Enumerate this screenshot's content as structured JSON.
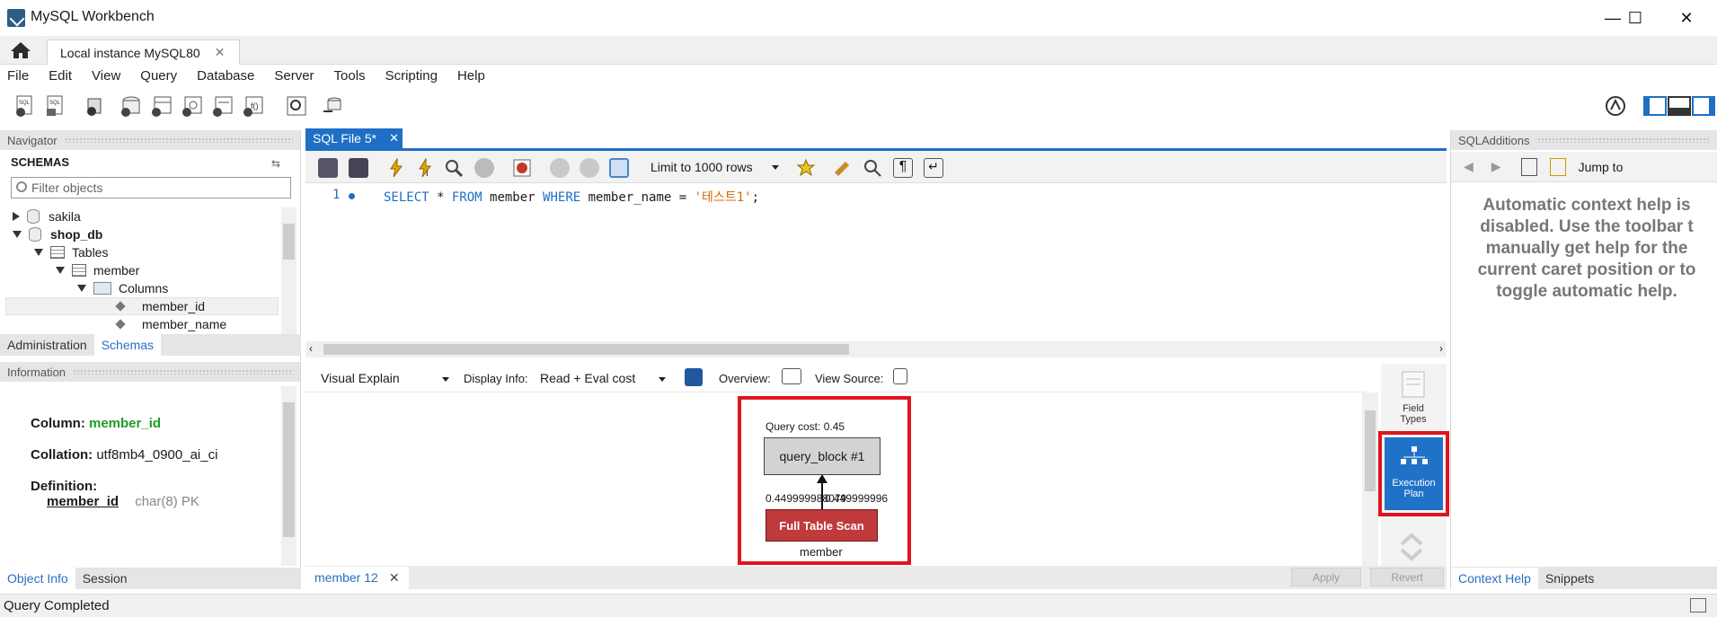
{
  "window": {
    "title": "MySQL Workbench",
    "minimize": "—",
    "maximize": "☐",
    "close": "✕"
  },
  "tabs": {
    "connection": "Local instance MySQL80",
    "close": "✕"
  },
  "menu": [
    "File",
    "Edit",
    "View",
    "Query",
    "Database",
    "Server",
    "Tools",
    "Scripting",
    "Help"
  ],
  "navigator": {
    "header": "Navigator",
    "schemas_label": "SCHEMAS",
    "filter_placeholder": "Filter objects",
    "tree": {
      "sakila": "sakila",
      "shop_db": "shop_db",
      "tables": "Tables",
      "member": "member",
      "columns": "Columns",
      "col1": "member_id",
      "col2": "member_name"
    },
    "tabs": [
      "Administration",
      "Schemas"
    ]
  },
  "information": {
    "header": "Information",
    "column_label": "Column:",
    "column_value": "member_id",
    "collation_label": "Collation:",
    "collation_value": "utf8mb4_0900_ai_ci",
    "definition_label": "Definition:",
    "def_name": "member_id",
    "def_type": "char(8) PK",
    "tabs": [
      "Object Info",
      "Session"
    ]
  },
  "editor": {
    "tab_title": "SQL File 5*",
    "limit": "Limit to 1000 rows",
    "line_number": "1",
    "code": {
      "kw1": "SELECT",
      "mid1": " * ",
      "kw2": "FROM",
      "mid2": " member ",
      "kw3": "WHERE",
      "mid3": " member_name = ",
      "str": "'테스트1'",
      "end": ";"
    }
  },
  "explain": {
    "view": "Visual Explain",
    "display_info_label": "Display Info:",
    "display_info_value": "Read + Eval cost",
    "overview_label": "Overview:",
    "view_source_label": "View Source:",
    "query_cost": "Query cost: 0.45",
    "query_block": "query_block #1",
    "rows_label": "0.449999988079",
    "rows_label_overlap": "0.449999996",
    "scan": "Full Table Scan",
    "table": "member"
  },
  "rail": {
    "field_types": "Field Types",
    "execution_plan": "Execution Plan"
  },
  "result": {
    "tab": "member 12",
    "apply": "Apply",
    "revert": "Revert"
  },
  "sql_additions": {
    "header": "SQLAdditions",
    "jump_to": "Jump to",
    "help_lines": [
      "Automatic context help is",
      "disabled. Use the toolbar t",
      "manually get help for the",
      "current caret position or to",
      "toggle automatic help."
    ],
    "tabs": [
      "Context Help",
      "Snippets"
    ]
  },
  "status": "Query Completed",
  "colors": {
    "accent": "#1f6fc5",
    "highlight": "#e0141e",
    "scan": "#c0393b"
  }
}
